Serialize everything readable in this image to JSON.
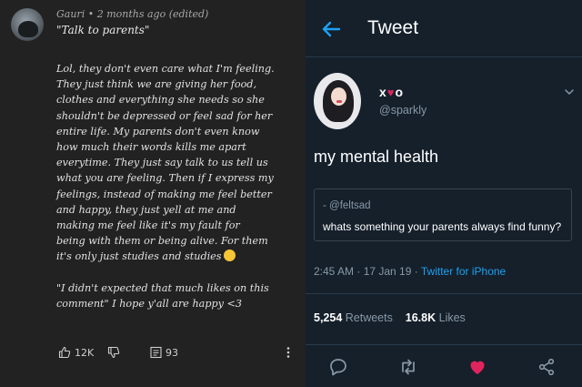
{
  "comment": {
    "author": "Gauri",
    "separator": "•",
    "age": "2 months ago (edited)",
    "quote": "\"Talk to parents\"",
    "lines": [
      "Lol, they don't even care what I'm feeling.",
      "They just think we are giving her food,",
      "clothes and everything she needs so she",
      "shouldn't be depressed or feel sad for her",
      "entire life. My parents don't even know",
      "how much their words kills me apart",
      "everytime. They just say talk to us tell us",
      "what you are feeling. Then if I express my",
      "feelings, instead of making me feel better",
      "and happy, they just yell at me and",
      "making me feel like it's my fault for",
      "being with them or being alive. For them",
      "it's only just studies and studies"
    ],
    "closing_lines": [
      "\"I didn't expected that much likes on this",
      "comment\" I hope y'all are happy <3"
    ],
    "likes": "12K",
    "replies": "93",
    "icons": [
      "thumbs-up-icon",
      "thumbs-down-icon",
      "comment-icon",
      "more-vertical-icon"
    ]
  },
  "tweet": {
    "header_title": "Tweet",
    "display_name_prefix": "x",
    "display_name_heart": "♥",
    "display_name_suffix": "o",
    "handle": "@sparkly",
    "text": "my mental health",
    "quote": {
      "handle": "- @feltsad",
      "text": "whats something your parents always find funny?"
    },
    "time": "2:45 AM · 17 Jan 19 · ",
    "client": "Twitter for iPhone",
    "retweets_count": "5,254",
    "retweets_label": " Retweets",
    "likes_count": "16.8K",
    "likes_label": " Likes",
    "colors": {
      "background": "#15202b",
      "accent": "#1da1f2",
      "like": "#e0245e",
      "muted": "#8899a6"
    }
  }
}
